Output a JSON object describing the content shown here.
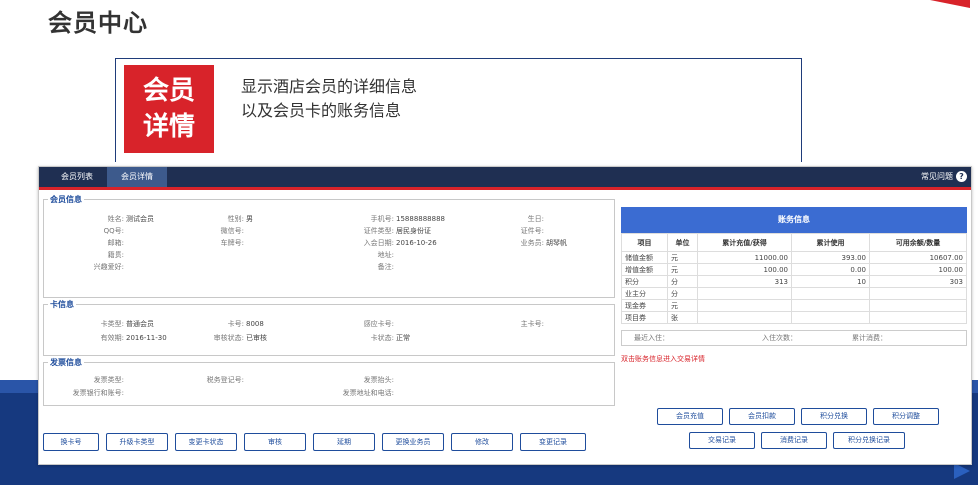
{
  "slide": {
    "title": "会员中心",
    "badge_line1": "会员",
    "badge_line2": "详情",
    "desc_line1": "显示酒店会员的详细信息",
    "desc_line2": "以及会员卡的账务信息"
  },
  "nav": {
    "tabs": [
      "会员列表",
      "会员详情"
    ],
    "help_label": "常见问题"
  },
  "member": {
    "section_title": "会员信息",
    "name_label": "姓名:",
    "name": "测试会员",
    "gender_label": "性别:",
    "gender": "男",
    "phone_label": "手机号:",
    "phone": "15888888888",
    "birthday_label": "生日:",
    "birthday": "",
    "qq_label": "QQ号:",
    "wechat_label": "微信号:",
    "idtype_label": "证件类型:",
    "idtype": "居民身份证",
    "idno_label": "证件号:",
    "email_label": "邮箱:",
    "plate_label": "车牌号:",
    "joindate_label": "入会日期:",
    "joindate": "2016-10-26",
    "sales_label": "业务员:",
    "sales": "胡琴帆",
    "origin_label": "籍贯:",
    "address_label": "地址:",
    "hobby_label": "兴趣爱好:",
    "remark_label": "备注:"
  },
  "card": {
    "section_title": "卡信息",
    "type_label": "卡类型:",
    "type": "普通会员",
    "no_label": "卡号:",
    "no": "8008",
    "sense_label": "感应卡号:",
    "main_label": "主卡号:",
    "expire_label": "有效期:",
    "expire": "2016-11-30",
    "audit_label": "审核状态:",
    "audit": "已审核",
    "status_label": "卡状态:",
    "status": "正常"
  },
  "invoice": {
    "section_title": "发票信息",
    "type_label": "发票类型:",
    "tax_label": "税务登记号:",
    "head_label": "发票抬头:",
    "bank_label": "发票银行和账号:",
    "addr_label": "发票地址和电话:"
  },
  "buttons": [
    "换卡号",
    "升级卡类型",
    "变更卡状态",
    "审核",
    "延期",
    "更换业务员",
    "修改",
    "变更记录"
  ],
  "account": {
    "title": "账务信息",
    "headers": [
      "项目",
      "单位",
      "累计充值/获得",
      "累计使用",
      "可用余额/数量"
    ],
    "rows": [
      [
        "储值金额",
        "元",
        "11000.00",
        "393.00",
        "10607.00"
      ],
      [
        "增值金额",
        "元",
        "100.00",
        "0.00",
        "100.00"
      ],
      [
        "积分",
        "分",
        "313",
        "10",
        "303"
      ],
      [
        "业主分",
        "分",
        "",
        "",
        ""
      ],
      [
        "现金券",
        "元",
        "",
        "",
        ""
      ],
      [
        "项目券",
        "张",
        "",
        "",
        ""
      ]
    ],
    "recent_stay": "最近入住：",
    "stay_count": "入住次数：",
    "total_spend": "累计消费：",
    "hint": "双击账务信息进入交易详情",
    "actions_row1": [
      "会员充值",
      "会员扣款",
      "积分兑换",
      "积分调整"
    ],
    "actions_row2": [
      "交易记录",
      "消费记录",
      "积分兑换记录"
    ]
  }
}
